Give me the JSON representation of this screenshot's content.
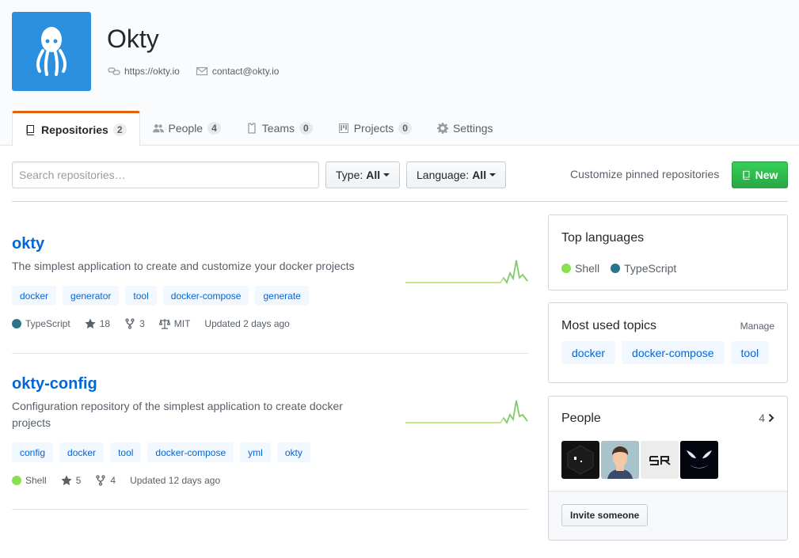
{
  "org": {
    "name": "Okty",
    "website": "https://okty.io",
    "email": "contact@okty.io",
    "avatar_color": "#2b90e0"
  },
  "tabs": [
    {
      "label": "Repositories",
      "count": "2"
    },
    {
      "label": "People",
      "count": "4"
    },
    {
      "label": "Teams",
      "count": "0"
    },
    {
      "label": "Projects",
      "count": "0"
    },
    {
      "label": "Settings"
    }
  ],
  "filters": {
    "search_placeholder": "Search repositories…",
    "type_label": "Type:",
    "type_value": "All",
    "language_label": "Language:",
    "language_value": "All",
    "customize": "Customize pinned repositories",
    "new_label": "New"
  },
  "repos": [
    {
      "name": "okty",
      "description": "The simplest application to create and customize your docker projects",
      "topics": [
        "docker",
        "generator",
        "tool",
        "docker-compose",
        "generate"
      ],
      "language": "TypeScript",
      "language_color": "#2b7489",
      "stars": "18",
      "forks": "3",
      "license": "MIT",
      "updated": "Updated 2 days ago"
    },
    {
      "name": "okty-config",
      "description": "Configuration repository of the simplest application to create docker projects",
      "topics": [
        "config",
        "docker",
        "tool",
        "docker-compose",
        "yml",
        "okty"
      ],
      "language": "Shell",
      "language_color": "#89e051",
      "stars": "5",
      "forks": "4",
      "updated": "Updated 12 days ago"
    }
  ],
  "sidebar": {
    "top_languages": {
      "title": "Top languages",
      "items": [
        {
          "name": "Shell",
          "color": "#89e051"
        },
        {
          "name": "TypeScript",
          "color": "#2b7489"
        }
      ]
    },
    "topics": {
      "title": "Most used topics",
      "manage": "Manage",
      "items": [
        "docker",
        "docker-compose",
        "tool"
      ]
    },
    "people": {
      "title": "People",
      "count": "4",
      "invite": "Invite someone"
    }
  }
}
